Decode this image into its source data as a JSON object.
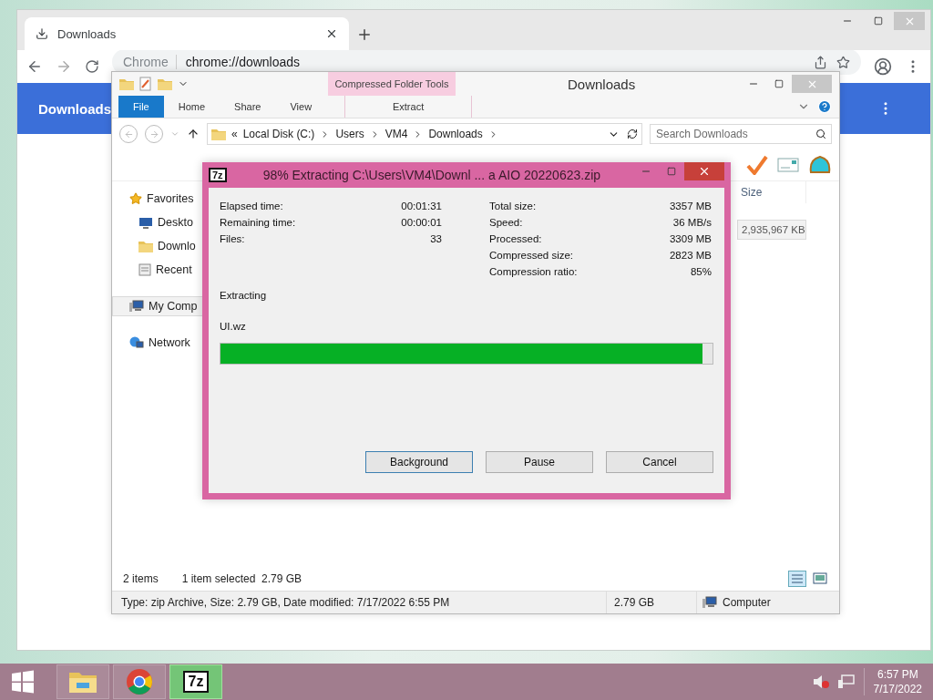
{
  "chrome": {
    "tab": {
      "label": "Downloads",
      "selected": true
    },
    "omnibox": {
      "chip": "Chrome",
      "url": "chrome://downloads"
    },
    "header": {
      "title": "Downloads"
    }
  },
  "explorer": {
    "title": "Downloads",
    "context_tab": "Compressed Folder Tools",
    "ribbon_tabs": [
      {
        "label": "File",
        "kind": "file"
      },
      {
        "label": "Home",
        "kind": "tab"
      },
      {
        "label": "Share",
        "kind": "tab"
      },
      {
        "label": "View",
        "kind": "tab"
      },
      {
        "label": "Extract",
        "kind": "context"
      }
    ],
    "breadcrumb": {
      "overflow": "«",
      "parts": [
        "Local Disk (C:)",
        "Users",
        "VM4",
        "Downloads"
      ]
    },
    "search": {
      "placeholder": "Search Downloads"
    },
    "nav": [
      {
        "label": "Favorites",
        "kind": "favorites",
        "selected": false,
        "children": [
          {
            "label": "Deskto",
            "kind": "desktop",
            "selected": false
          },
          {
            "label": "Downlo",
            "kind": "downloads",
            "selected": false
          },
          {
            "label": "Recent",
            "kind": "recent",
            "selected": false
          }
        ]
      },
      {
        "label": "My Comp",
        "kind": "computer",
        "selected": true
      },
      {
        "label": "Network",
        "kind": "network",
        "selected": false
      }
    ],
    "columns": [
      "Size"
    ],
    "rows": [
      {
        "size": "2,935,967 KB",
        "selected": true
      }
    ],
    "status": {
      "count": "2 items",
      "selection": "1 item selected  2.79 GB"
    },
    "details_bar": {
      "info": "Type: zip Archive, Size: 2.79 GB, Date modified: 7/17/2022 6:55 PM",
      "size": "2.79 GB",
      "location": "Computer"
    }
  },
  "dialog": {
    "logo": "7z",
    "title": "98% Extracting C:\\Users\\VM4\\Downl ... a AIO 20220623.zip",
    "stats_left": [
      {
        "label": "Elapsed time:",
        "value": "00:01:31"
      },
      {
        "label": "Remaining time:",
        "value": "00:00:01"
      },
      {
        "label": "Files:",
        "value": "33"
      }
    ],
    "stats_right": [
      {
        "label": "Total size:",
        "value": "3357 MB"
      },
      {
        "label": "Speed:",
        "value": "36 MB/s"
      },
      {
        "label": "Processed:",
        "value": "3309 MB"
      },
      {
        "label": "Compressed size:",
        "value": "2823 MB"
      },
      {
        "label": "Compression ratio:",
        "value": "85%"
      }
    ],
    "operation": "Extracting",
    "current_file": "UI.wz",
    "progress": {
      "level": 0.98
    },
    "buttons": [
      "Background",
      "Pause",
      "Cancel"
    ]
  },
  "taskbar": {
    "apps": [
      {
        "kind": "explorer",
        "selected": false
      },
      {
        "kind": "chrome",
        "selected": false
      },
      {
        "kind": "sevenzip",
        "label": "7z",
        "selected": true
      }
    ],
    "time": "6:57 PM",
    "date": "7/17/2022"
  }
}
